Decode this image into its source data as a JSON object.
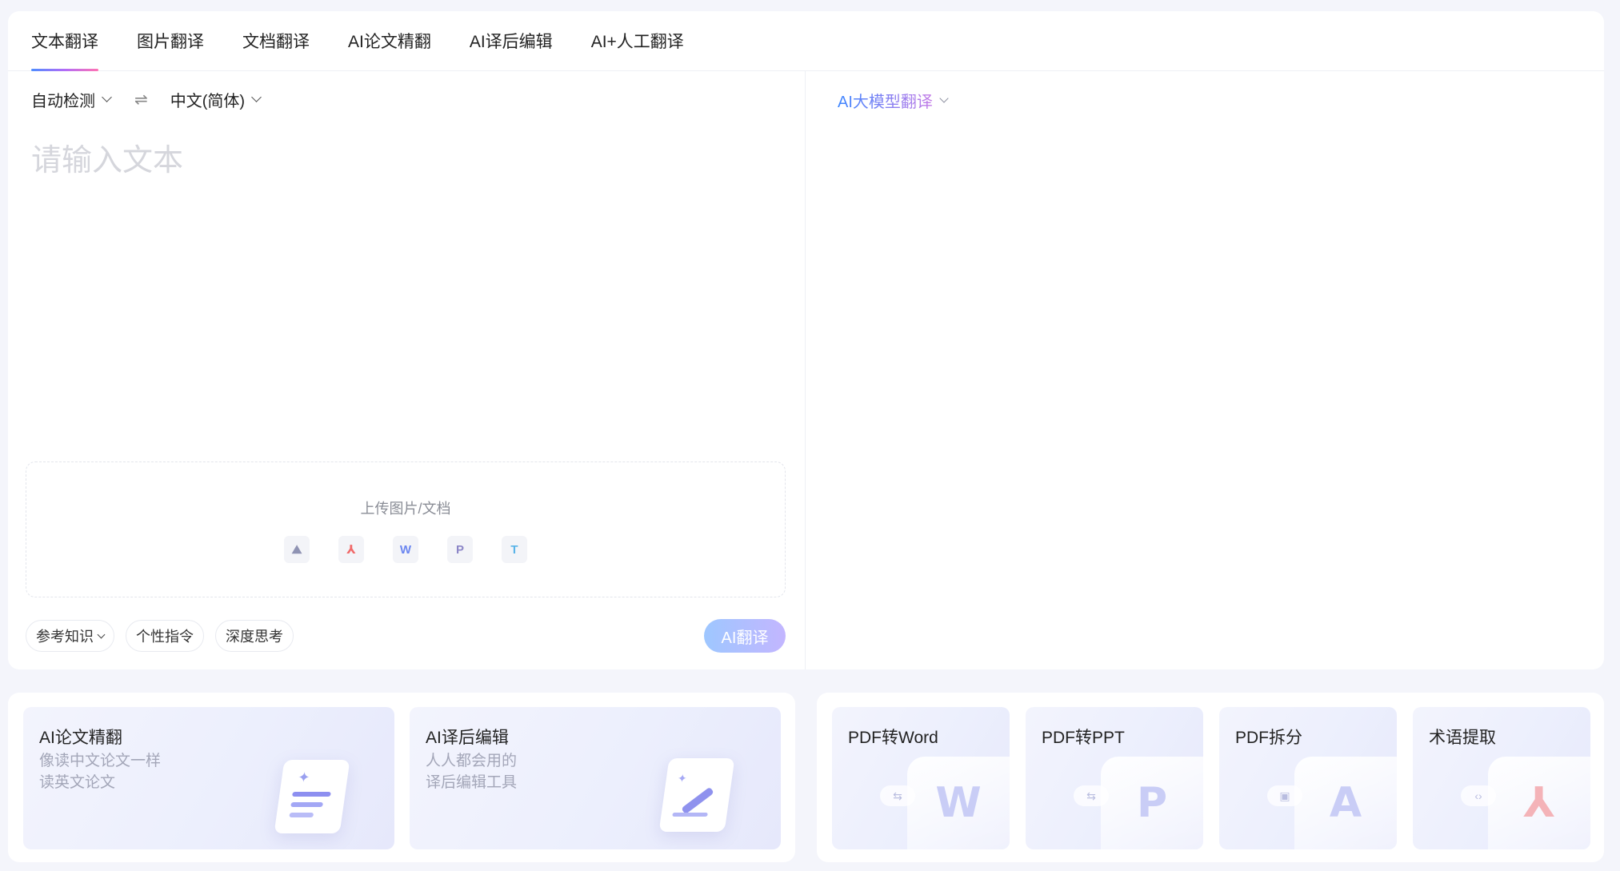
{
  "tabs": [
    {
      "label": "文本翻译"
    },
    {
      "label": "图片翻译"
    },
    {
      "label": "文档翻译"
    },
    {
      "label": "AI论文精翻"
    },
    {
      "label": "AI译后编辑"
    },
    {
      "label": "AI+人工翻译"
    }
  ],
  "source": {
    "lang_from": "自动检测",
    "swap_symbol": "⇌",
    "lang_to": "中文(简体)",
    "placeholder": "请输入文本",
    "upload_label": "上传图片/文档",
    "upload_icons": [
      {
        "glyph": "⛰",
        "color": "#8f93b3"
      },
      {
        "glyph": "⅄",
        "color": "#f06a6a"
      },
      {
        "glyph": "W",
        "color": "#6b86f0"
      },
      {
        "glyph": "P",
        "color": "#8c86c7"
      },
      {
        "glyph": "T",
        "color": "#5ab4e8"
      }
    ],
    "pills": {
      "reference": "参考知识",
      "instruction": "个性指令",
      "deep_think": "深度思考"
    },
    "translate_button": "AI翻译"
  },
  "target": {
    "model": "AI大模型翻译"
  },
  "promo": {
    "cards": [
      {
        "title": "AI论文精翻",
        "subtitle_1": "像读中文论文一样",
        "subtitle_2": "读英文论文"
      },
      {
        "title": "AI译后编辑",
        "subtitle_1": "人人都会用的",
        "subtitle_2": "译后编辑工具"
      }
    ],
    "tools": [
      {
        "title": "PDF转Word",
        "letter": "W",
        "chip": "⇆"
      },
      {
        "title": "PDF转PPT",
        "letter": "P",
        "chip": "⇆"
      },
      {
        "title": "PDF拆分",
        "letter": "A",
        "chip": "▣"
      },
      {
        "title": "术语提取",
        "letter": "⅄",
        "chip": "‹›"
      }
    ]
  }
}
